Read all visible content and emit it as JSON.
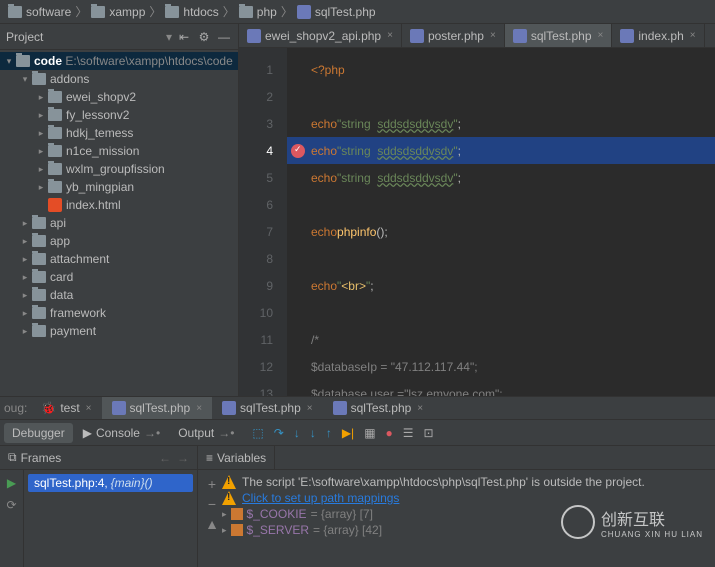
{
  "breadcrumb": [
    "software",
    "xampp",
    "htdocs",
    "php",
    "sqlTest.php"
  ],
  "project": {
    "title": "Project",
    "root": {
      "name": "code",
      "path": "E:\\software\\xampp\\htdocs\\code"
    },
    "tree": [
      {
        "name": "addons",
        "depth": 1,
        "exp": true,
        "icon": "folder"
      },
      {
        "name": "ewei_shopv2",
        "depth": 2,
        "exp": false,
        "icon": "folder"
      },
      {
        "name": "fy_lessonv2",
        "depth": 2,
        "exp": false,
        "icon": "folder"
      },
      {
        "name": "hdkj_temess",
        "depth": 2,
        "exp": false,
        "icon": "folder"
      },
      {
        "name": "n1ce_mission",
        "depth": 2,
        "exp": false,
        "icon": "folder"
      },
      {
        "name": "wxlm_groupfission",
        "depth": 2,
        "exp": false,
        "icon": "folder"
      },
      {
        "name": "yb_mingpian",
        "depth": 2,
        "exp": false,
        "icon": "folder"
      },
      {
        "name": "index.html",
        "depth": 2,
        "exp": null,
        "icon": "html"
      },
      {
        "name": "api",
        "depth": 1,
        "exp": false,
        "icon": "folder"
      },
      {
        "name": "app",
        "depth": 1,
        "exp": false,
        "icon": "folder"
      },
      {
        "name": "attachment",
        "depth": 1,
        "exp": false,
        "icon": "folder"
      },
      {
        "name": "card",
        "depth": 1,
        "exp": false,
        "icon": "folder"
      },
      {
        "name": "data",
        "depth": 1,
        "exp": false,
        "icon": "folder"
      },
      {
        "name": "framework",
        "depth": 1,
        "exp": false,
        "icon": "folder"
      },
      {
        "name": "payment",
        "depth": 1,
        "exp": false,
        "icon": "folder"
      }
    ]
  },
  "tabs": [
    {
      "label": "ewei_shopv2_api.php",
      "active": false
    },
    {
      "label": "poster.php",
      "active": false
    },
    {
      "label": "sqlTest.php",
      "active": true
    },
    {
      "label": "index.ph",
      "active": false
    }
  ],
  "code": {
    "lines": [
      {
        "n": 1,
        "html": "<span class='kw'>&lt;?php</span>"
      },
      {
        "n": 2,
        "html": ""
      },
      {
        "n": 3,
        "html": "<span class='kw'>echo</span> <span class='str'>\"string  </span><span class='ustr'>sddsdsddvsdv</span><span class='str'>\"</span>;"
      },
      {
        "n": 4,
        "html": "<span class='kw'>echo</span> <span class='str'>\"string  </span><span class='ustr'>sddsdsddvsdv</span><span class='str'>\"</span>;",
        "hl": true,
        "bp": true
      },
      {
        "n": 5,
        "html": "<span class='kw'>echo</span> <span class='str'>\"string  </span><span class='ustr'>sddsdsddvsdv</span><span class='str'>\"</span>;"
      },
      {
        "n": 6,
        "html": ""
      },
      {
        "n": 7,
        "html": "<span class='kw'>echo</span> <span class='fn'>phpinfo</span>();"
      },
      {
        "n": 8,
        "html": ""
      },
      {
        "n": 9,
        "html": "<span class='kw'>echo</span> <span class='str'>\"</span><span class='tag'>&lt;br&gt;</span><span class='str'>\"</span>;"
      },
      {
        "n": 10,
        "html": ""
      },
      {
        "n": 11,
        "html": "<span class='cmt'>/*</span>"
      },
      {
        "n": 12,
        "html": "<span class='cmt'>$databaseIp = \"47.112.117.44\";</span>"
      },
      {
        "n": 13,
        "html": "<span class='cmt'>$database user =\"lsz emyone com\";</span>"
      }
    ]
  },
  "bottomTabs": {
    "prefix": "oug:",
    "items": [
      {
        "label": "test",
        "icon": "bug"
      },
      {
        "label": "sqlTest.php",
        "icon": "php",
        "active": true
      },
      {
        "label": "sqlTest.php",
        "icon": "php"
      },
      {
        "label": "sqlTest.php",
        "icon": "php"
      }
    ]
  },
  "debugger": {
    "tabs": [
      {
        "label": "Debugger",
        "active": true
      },
      {
        "label": "Console"
      },
      {
        "label": "Output"
      }
    ],
    "framesTitle": "Frames",
    "varsTitle": "Variables",
    "frame": {
      "file": "sqlTest.php",
      "line": 4,
      "fn": "{main}()"
    },
    "warnings": [
      {
        "text": "The script 'E:\\software\\xampp\\htdocs\\php\\sqlTest.php' is outside the project."
      },
      {
        "link": "Click to set up path mappings"
      }
    ],
    "vars": [
      {
        "name": "$_COOKIE",
        "type": "{array}",
        "count": "[7]"
      },
      {
        "name": "$_SERVER",
        "type": "{array}",
        "count": "[42]"
      }
    ]
  },
  "watermark": {
    "brand": "创新互联",
    "sub": "CHUANG XIN HU LIAN"
  }
}
